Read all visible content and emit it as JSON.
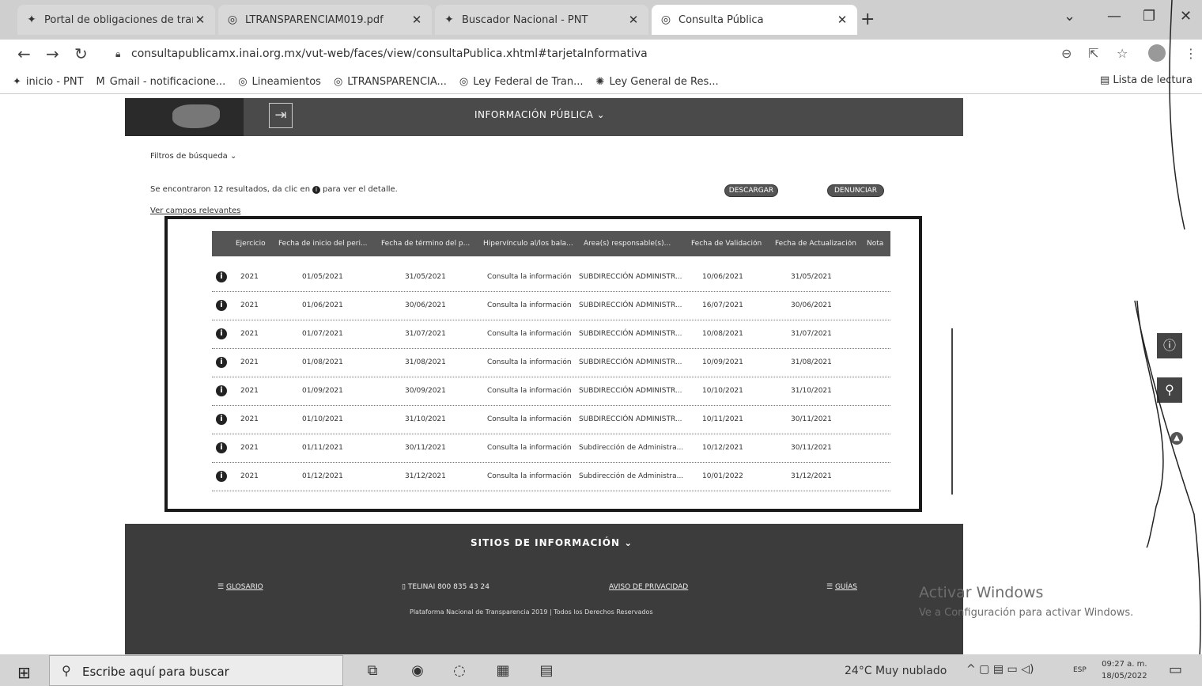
{
  "browser": {
    "tabs": [
      {
        "label": "Portal de obligaciones de transp",
        "icon": "pnt-icon"
      },
      {
        "label": "LTRANSPARENCIAM019.pdf",
        "icon": "globe-icon"
      },
      {
        "label": "Buscador Nacional - PNT",
        "icon": "pnt-icon"
      },
      {
        "label": "Consulta Pública",
        "icon": "globe-icon",
        "active": true
      }
    ],
    "url": "consultapublicamx.inai.org.mx/vut-web/faces/view/consultaPublica.xhtml#tarjetaInformativa",
    "bookmarks": [
      "inicio - PNT",
      "Gmail - notificacione...",
      "Lineamientos",
      "LTRANSPARENCIA...",
      "Ley Federal de Tran...",
      "Ley General de Res..."
    ],
    "reading_list": "Lista de lectura"
  },
  "page": {
    "nav_title": "INFORMACIÓN PÚBLICA",
    "filters": "Filtros de búsqueda",
    "results_text_pre": "Se encontraron 12 resultados, da clic en",
    "results_text_post": "para ver el detalle.",
    "download": "DESCARGAR",
    "report": "DENUNCIAR",
    "relevant": "Ver campos relevantes",
    "table": {
      "headers": [
        "Ejercicio",
        "Fecha de inicio del peri...",
        "Fecha de término del p...",
        "Hipervínculo al/los bala...",
        "Área(s) responsable(s)...",
        "Fecha de Validación",
        "Fecha de Actualización",
        "Nota"
      ],
      "rows": [
        [
          "2021",
          "01/05/2021",
          "31/05/2021",
          "Consulta la información",
          "SUBDIRECCIÓN ADMINISTR...",
          "10/06/2021",
          "31/05/2021"
        ],
        [
          "2021",
          "01/06/2021",
          "30/06/2021",
          "Consulta la información",
          "SUBDIRECCIÓN ADMINISTR...",
          "16/07/2021",
          "30/06/2021"
        ],
        [
          "2021",
          "01/07/2021",
          "31/07/2021",
          "Consulta la información",
          "SUBDIRECCIÓN ADMINISTR...",
          "10/08/2021",
          "31/07/2021"
        ],
        [
          "2021",
          "01/08/2021",
          "31/08/2021",
          "Consulta la información",
          "SUBDIRECCIÓN ADMINISTR...",
          "10/09/2021",
          "31/08/2021"
        ],
        [
          "2021",
          "01/09/2021",
          "30/09/2021",
          "Consulta la información",
          "SUBDIRECCIÓN ADMINISTR...",
          "10/10/2021",
          "31/10/2021"
        ],
        [
          "2021",
          "01/10/2021",
          "31/10/2021",
          "Consulta la información",
          "SUBDIRECCIÓN ADMINISTR...",
          "10/11/2021",
          "30/11/2021"
        ],
        [
          "2021",
          "01/11/2021",
          "30/11/2021",
          "Consulta la información",
          "Subdirección de Administra...",
          "10/12/2021",
          "30/11/2021"
        ],
        [
          "2021",
          "01/12/2021",
          "31/12/2021",
          "Consulta la información",
          "Subdirección de Administra...",
          "10/01/2022",
          "31/12/2021"
        ]
      ]
    },
    "footer": {
      "sites": "SITIOS DE INFORMACIÓN",
      "glossary": "GLOSARIO",
      "phone": "TELINAI 800 835 43 24",
      "privacy": "AVISO DE PRIVACIDAD",
      "guides": "GUÍAS",
      "copyright": "Plataforma Nacional de Transparencia 2019 | Todos los Derechos Reservados"
    },
    "watermark_title": "Activar Windows",
    "watermark_sub": "Ve a Configuración para activar Windows."
  },
  "taskbar": {
    "search": "Escribe aquí para buscar",
    "weather": "24°C Muy nublado",
    "lang": "ESP",
    "time": "09:27 a. m.",
    "date": "18/05/2022"
  }
}
